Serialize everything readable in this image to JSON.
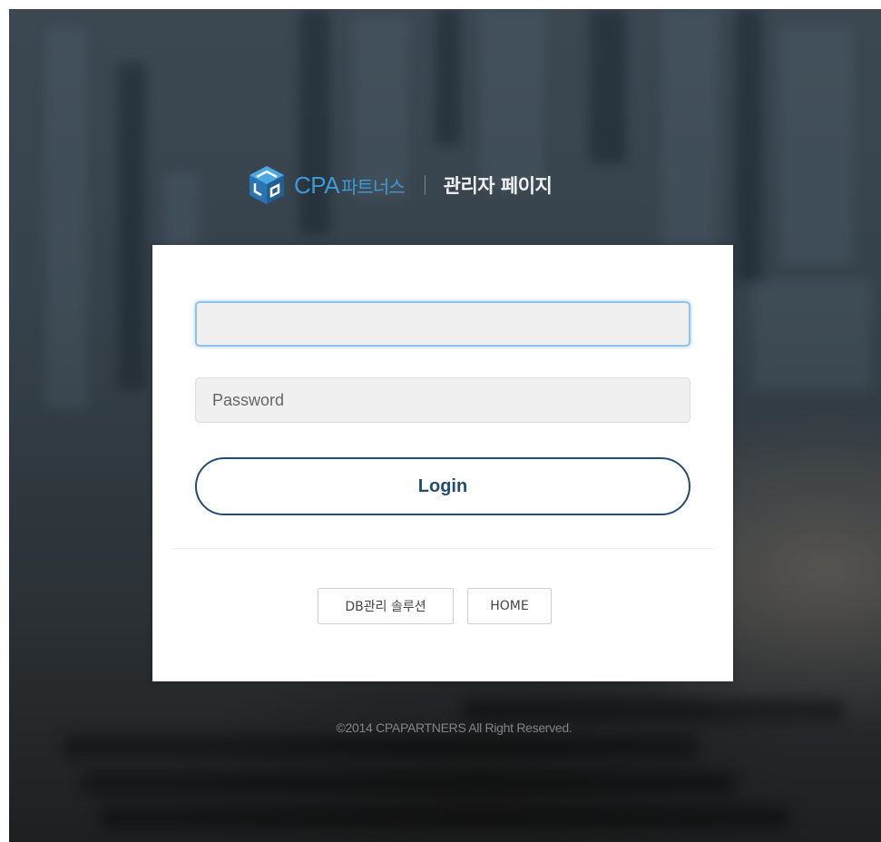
{
  "header": {
    "brand_cpa": "CPA",
    "brand_korean": "파트너스",
    "admin_title": "관리자 페이지"
  },
  "login_form": {
    "username_value": "",
    "username_placeholder": "",
    "password_value": "",
    "password_placeholder": "Password",
    "login_label": "Login"
  },
  "links": {
    "db_solution_label": "DB관리 솔루션",
    "home_label": "HOME"
  },
  "footer": {
    "copyright": "©2014 CPAPARTNERS All Right Reserved."
  },
  "icons": {
    "logo": "cube-logo-icon"
  },
  "colors": {
    "brand_blue": "#3c9ad6",
    "button_navy": "#254d6e",
    "focus_blue": "#8fc2ee"
  }
}
